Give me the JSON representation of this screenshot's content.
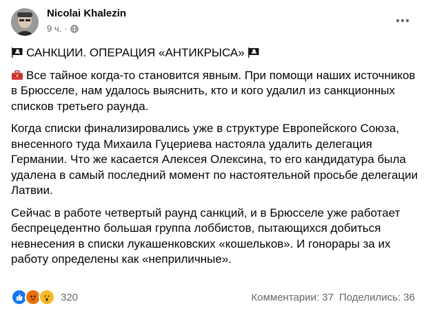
{
  "post": {
    "author": "Nicolai Khalezin",
    "time": "9 ч.",
    "time_sep": "·",
    "audience_icon": "globe-icon",
    "more_icon": "ellipsis-icon",
    "title_line": "САНКЦИИ. ОПЕРАЦИЯ «АНТИКРЫСА»",
    "paragraph1": "Все тайное когда-то становится явным. При помощи наших источников в Брюсселе, нам удалось выяснить, кто и кого удалил из санкционных списков третьего раунда.",
    "paragraph2": "Когда списки финализировались уже в структуре Европейского Союза, внесенного туда Михаила Гуцериева настояла удалить делегация Германии. Что же касается Алексея Олексина, то его кандидатура была удалена в самый последний момент по настоятельной просьбе делегации Латвии.",
    "paragraph3": "Сейчас в работе четвертый раунд санкций, и в Брюсселе уже работает беспрецедентно большая группа лоббистов, пытающихся добиться невнесения в списки лукашенковских «кошельков». И гонорары за их работу определены как «неприличные».",
    "title_icon": "pirate-flag-icon",
    "para1_icon": "toolbox-icon"
  },
  "footer": {
    "reaction_icons": [
      "like-icon",
      "angry-icon",
      "wow-icon"
    ],
    "reaction_count": "320",
    "comments": "Комментарии: 37",
    "shares": "Поделились: 36"
  },
  "colors": {
    "like": "#1877f2",
    "angry": "#e9710f",
    "wow": "#f7b928",
    "meta_text": "#65676b"
  }
}
